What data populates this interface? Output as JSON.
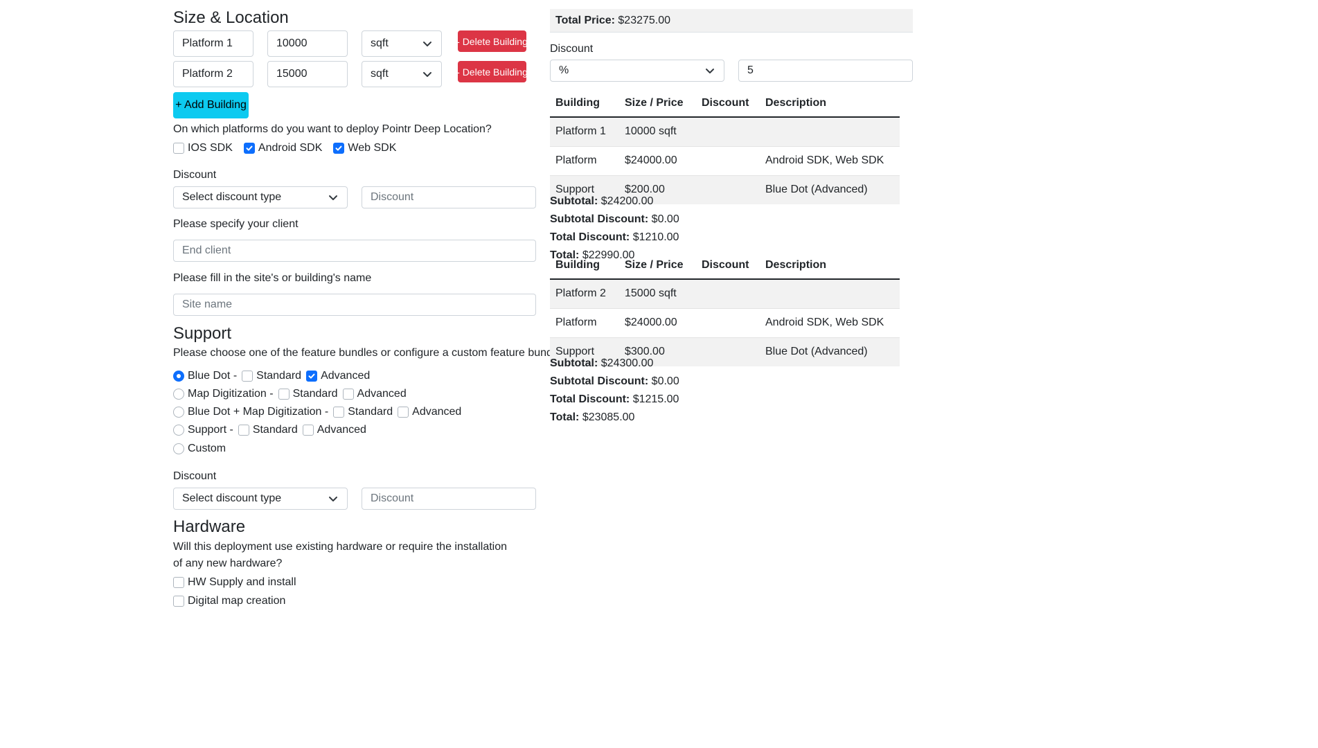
{
  "size_location": {
    "title": "Size & Location",
    "buildings": [
      {
        "name": "Platform 1",
        "size": "10000",
        "unit": "sqft",
        "delete_label": "- Delete Building"
      },
      {
        "name": "Platform 2",
        "size": "15000",
        "unit": "sqft",
        "delete_label": "- Delete Building"
      }
    ],
    "add_building_label": "+ Add Building",
    "platforms_question": "On which platforms do you want to deploy Pointr Deep Location?",
    "platforms": [
      {
        "label": "IOS SDK",
        "checked": false
      },
      {
        "label": "Android SDK",
        "checked": true
      },
      {
        "label": "Web SDK",
        "checked": true
      }
    ],
    "discount_label": "Discount",
    "discount_type_placeholder": "Select discount type",
    "discount_placeholder": "Discount",
    "client_label": "Please specify your client",
    "client_placeholder": "End client",
    "site_label": "Please fill in the site's or building's name",
    "site_placeholder": "Site name"
  },
  "support": {
    "title": "Support",
    "intro": "Please choose one of the feature bundles or configure a custom feature bundle",
    "options": [
      {
        "label": "Blue Dot -",
        "selected": true,
        "standard": false,
        "advanced": true
      },
      {
        "label": "Map Digitization -",
        "selected": false,
        "standard": false,
        "advanced": false
      },
      {
        "label": "Blue Dot + Map Digitization -",
        "selected": false,
        "standard": false,
        "advanced": false
      },
      {
        "label": "Support -",
        "selected": false,
        "standard": false,
        "advanced": false
      },
      {
        "label": "Custom",
        "selected": false
      }
    ],
    "standard_label": "Standard",
    "advanced_label": "Advanced",
    "discount_label": "Discount",
    "discount_type_placeholder": "Select discount type",
    "discount_placeholder": "Discount"
  },
  "hardware": {
    "title": "Hardware",
    "question": "Will this deployment use existing hardware or require the installation of any new hardware?",
    "options": [
      {
        "label": "HW Supply and install",
        "checked": false
      },
      {
        "label": "Digital map creation",
        "checked": false
      }
    ]
  },
  "summary": {
    "total_price_label": "Total Price:",
    "total_price_value": "$23275.00",
    "discount_label": "Discount",
    "discount_type": "%",
    "discount_value": "5",
    "columns": [
      "Building",
      "Size / Price",
      "Discount",
      "Description"
    ],
    "buildings": [
      {
        "rows": [
          [
            "Platform 1",
            "10000 sqft",
            "",
            ""
          ],
          [
            "Platform",
            "$24000.00",
            "",
            "Android SDK, Web SDK"
          ],
          [
            "Support",
            "$200.00",
            "",
            "Blue Dot (Advanced)"
          ]
        ],
        "totals": [
          {
            "label": "Subtotal:",
            "value": "$24200.00"
          },
          {
            "label": "Subtotal Discount:",
            "value": "$0.00"
          },
          {
            "label": "Total Discount:",
            "value": "$1210.00"
          },
          {
            "label": "Total:",
            "value": "$22990.00"
          }
        ]
      },
      {
        "rows": [
          [
            "Platform 2",
            "15000 sqft",
            "",
            ""
          ],
          [
            "Platform",
            "$24000.00",
            "",
            "Android SDK, Web SDK"
          ],
          [
            "Support",
            "$300.00",
            "",
            "Blue Dot (Advanced)"
          ]
        ],
        "totals": [
          {
            "label": "Subtotal:",
            "value": "$24300.00"
          },
          {
            "label": "Subtotal Discount:",
            "value": "$0.00"
          },
          {
            "label": "Total Discount:",
            "value": "$1215.00"
          },
          {
            "label": "Total:",
            "value": "$23085.00"
          }
        ]
      }
    ]
  },
  "colors": {
    "danger": "#dc3545",
    "info": "#0dcaf0",
    "primary": "#0d6efd"
  }
}
